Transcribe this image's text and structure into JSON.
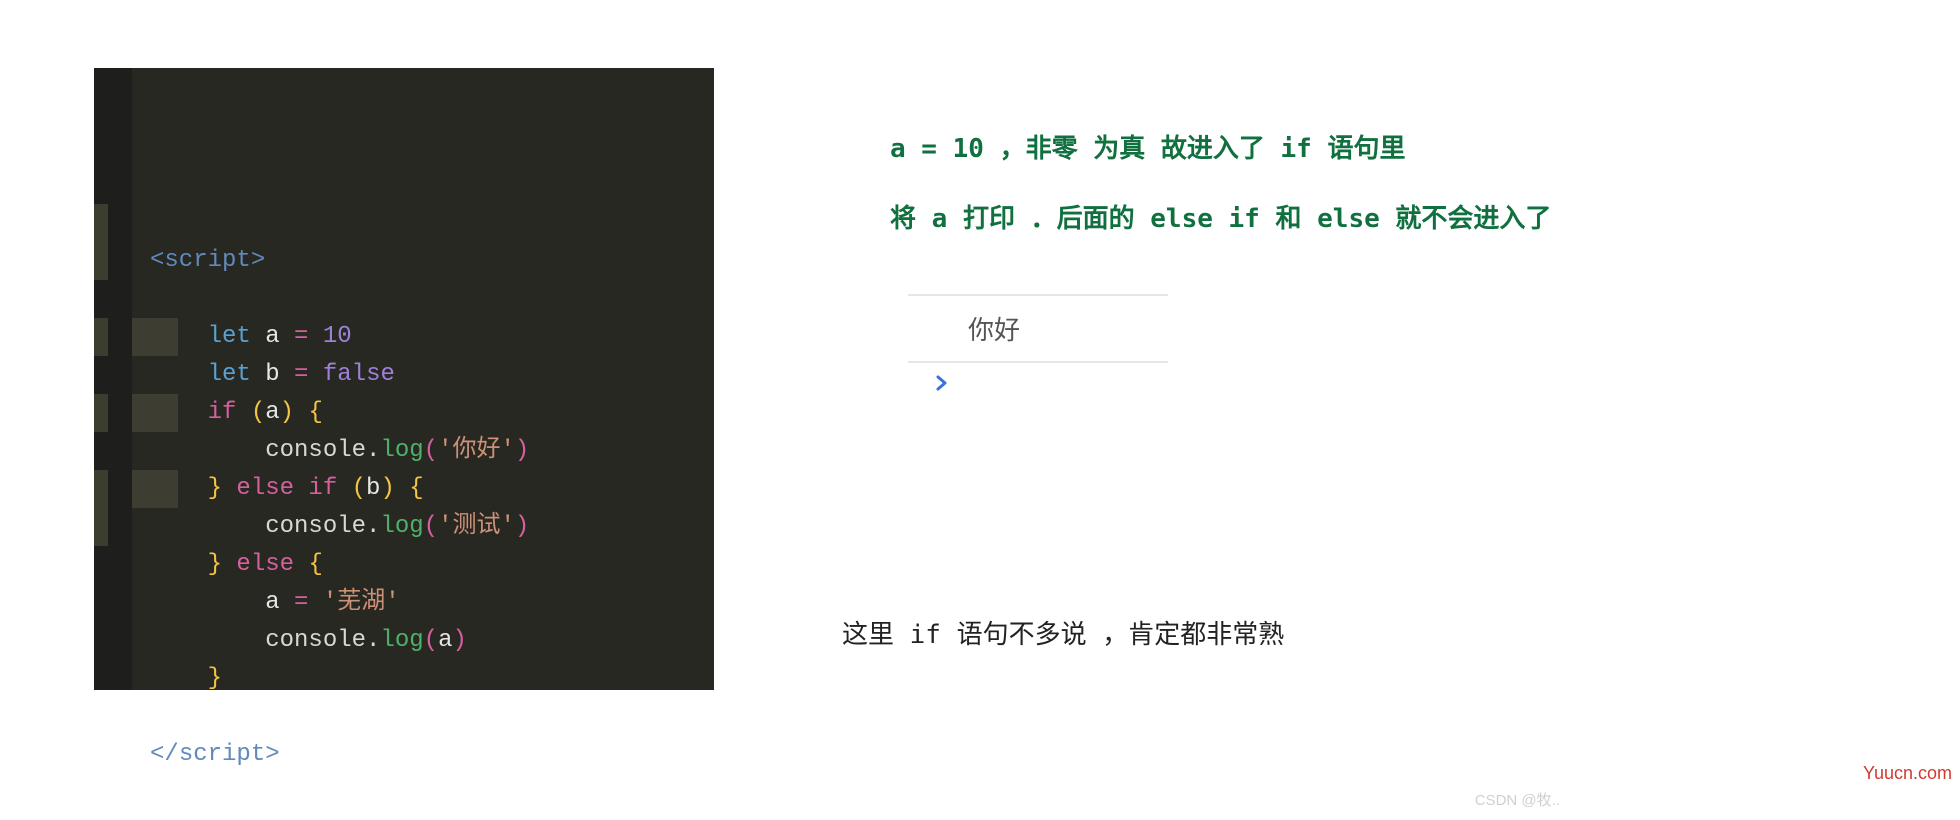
{
  "code": {
    "open_tag_lt": "<",
    "open_tag_name": "script",
    "open_tag_gt": ">",
    "let1_kw": "let",
    "let1_var": " a ",
    "let1_op": "=",
    "let1_val": " 10",
    "let2_kw": "let",
    "let2_var": " b ",
    "let2_op": "=",
    "let2_val": " false",
    "if_kw": "if",
    "if_sp": " ",
    "if_lp": "(",
    "if_cond": "a",
    "if_rp": ")",
    "if_lb": " {",
    "log_obj": "console",
    "log_dot": ".",
    "log_fn": "log",
    "log_lp": "(",
    "log_rp": ")",
    "log1_arg": "'你好'",
    "elseif_rb": "}",
    "elseif_kw": " else if ",
    "elseif_lp": "(",
    "elseif_cond": "b",
    "elseif_rp": ")",
    "elseif_lb": " {",
    "log2_arg": "'测试'",
    "else_rb": "}",
    "else_kw": " else ",
    "else_lb": "{",
    "assign_var": "a ",
    "assign_op": "=",
    "assign_val": " '芜湖'",
    "log3_arg": "a",
    "final_rb": "}",
    "close_tag_lt": "</",
    "close_tag_name": "script",
    "close_tag_gt": ">"
  },
  "notes": {
    "line1": "a = 10 ，非零 为真 故进入了 if 语句里",
    "line2": "将 a 打印 ．后面的 else if 和 else 就不会进入了"
  },
  "console": {
    "output": "你好"
  },
  "bottom": {
    "text": "这里 if 语句不多说 ，肯定都非常熟"
  },
  "watermarks": {
    "red": "Yuucn.com",
    "grey": "CSDN @牧.."
  }
}
